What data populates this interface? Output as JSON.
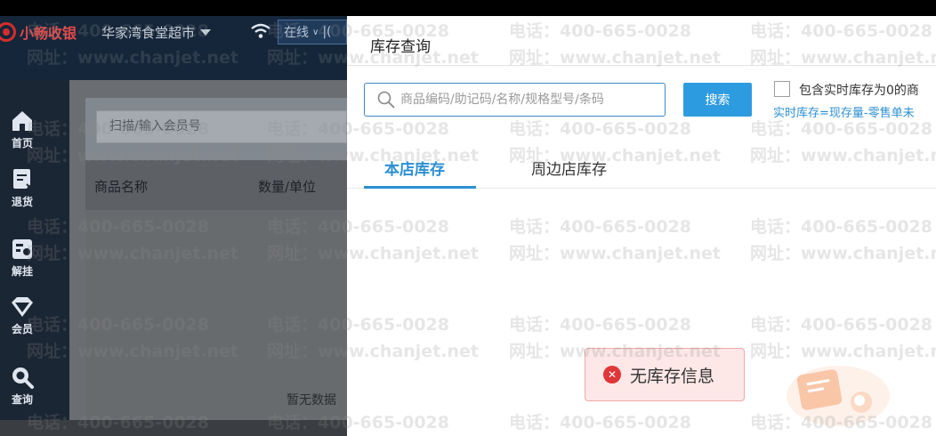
{
  "app": {
    "brand_name": "小畅收银",
    "store_name": "华家湾食堂超市",
    "status_label": "在线"
  },
  "sidebar": {
    "items": [
      {
        "label": "首页",
        "icon": "home-icon"
      },
      {
        "label": "退货",
        "icon": "return-icon"
      },
      {
        "label": "解挂",
        "icon": "unhold-icon"
      },
      {
        "label": "会员",
        "icon": "member-icon"
      },
      {
        "label": "查询",
        "icon": "search-icon"
      }
    ]
  },
  "pos": {
    "member_placeholder": "扫描/输入会员号",
    "columns": [
      "商品名称",
      "数量/单位"
    ],
    "empty_text": "暂无数据"
  },
  "modal": {
    "title": "库存查询",
    "search_placeholder": "商品编码/助记码/名称/规格型号/条码",
    "search_button": "搜索",
    "zero_stock_label": "包含实时库存为0的商",
    "formula_note": "实时库存=现存量-零售单未",
    "tabs": [
      {
        "label": "本店库存",
        "active": true
      },
      {
        "label": "周边店库存",
        "active": false
      }
    ]
  },
  "toast": {
    "message": "无库存信息",
    "icon": "error-icon"
  },
  "watermark": {
    "phone": "电话：400-665-0028",
    "site": "网址：www.chanjet.net"
  },
  "colors": {
    "accent": "#2d8fd2",
    "brand": "#d42d2d",
    "error": "#e0363a"
  }
}
